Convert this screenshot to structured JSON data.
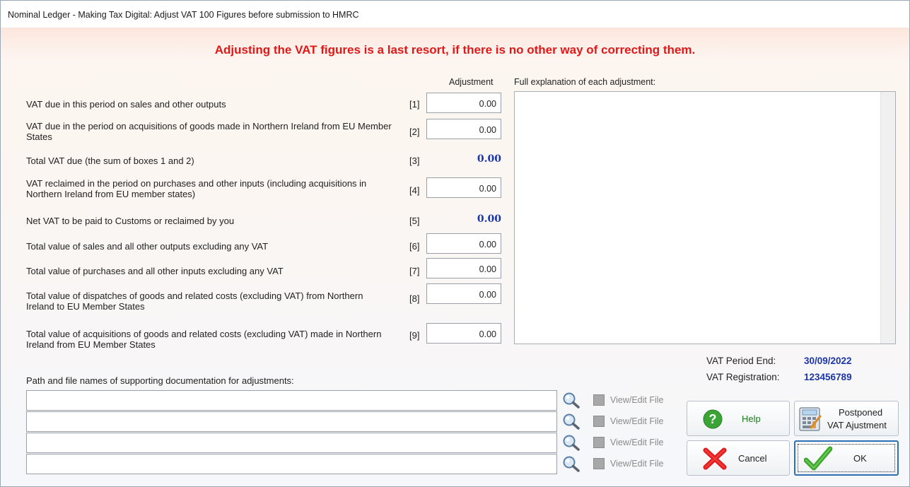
{
  "window": {
    "title": "Nominal Ledger  -  Making Tax Digital: Adjust VAT 100 Figures before submission to HMRC",
    "warning": "Adjusting the VAT figures is a last resort, if there is no other way of correcting them."
  },
  "headers": {
    "adjustment": "Adjustment",
    "explanation": "Full explanation of each adjustment:"
  },
  "rows": [
    {
      "label": "VAT due in this period on sales and other outputs",
      "num": "[1]",
      "value": "0.00"
    },
    {
      "label": "VAT due in the period on acquisitions of goods made in Northern Ireland from EU Member States",
      "num": "[2]",
      "value": "0.00"
    },
    {
      "label": "Total VAT due (the sum of boxes 1 and 2)",
      "num": "[3]",
      "value": "0.00"
    },
    {
      "label": "VAT reclaimed in the period on purchases and other inputs (including acquisitions in Northern Ireland from EU member states)",
      "num": "[4]",
      "value": "0.00"
    },
    {
      "label": "Net VAT to be paid to Customs or reclaimed by you",
      "num": "[5]",
      "value": "0.00"
    },
    {
      "label": "Total value of sales and all other outputs excluding any VAT",
      "num": "[6]",
      "value": "0.00"
    },
    {
      "label": "Total value of purchases and all other inputs excluding any VAT",
      "num": "[7]",
      "value": "0.00"
    },
    {
      "label": "Total value of dispatches of goods and related costs (excluding VAT) from Northern Ireland to EU Member States",
      "num": "[8]",
      "value": "0.00"
    },
    {
      "label": "Total value of acquisitions of goods and related costs (excluding VAT) made in Northern Ireland from EU Member States",
      "num": "[9]",
      "value": "0.00"
    }
  ],
  "vat_info": {
    "period_end_label": "VAT Period End:",
    "period_end": "30/09/2022",
    "registration_label": "VAT Registration:",
    "registration": "123456789"
  },
  "docs": {
    "label": "Path and file names of supporting documentation for adjustments:",
    "view_edit": "View/Edit File"
  },
  "buttons": {
    "help": "Help",
    "postponed_line1": "Postponed",
    "postponed_line2": "VAT Ajustment",
    "cancel": "Cancel",
    "ok": "OK"
  },
  "icons": [
    "search-icon",
    "help-icon",
    "calculator-icon",
    "cancel-x-icon",
    "checkmark-icon"
  ]
}
